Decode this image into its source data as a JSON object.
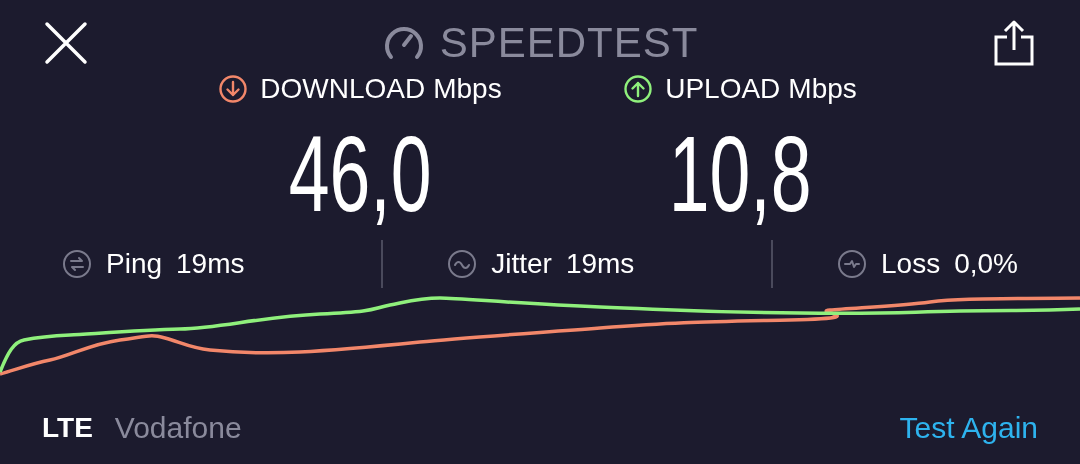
{
  "header": {
    "title": "SPEEDTEST"
  },
  "results": [
    {
      "kind": "download",
      "label": "DOWNLOAD",
      "unit": "Mbps",
      "value": "46,0"
    },
    {
      "kind": "upload",
      "label": "UPLOAD",
      "unit": "Mbps",
      "value": "10,8"
    }
  ],
  "stats": [
    {
      "kind": "ping",
      "label": "Ping",
      "value": "19ms"
    },
    {
      "kind": "jitter",
      "label": "Jitter",
      "value": "19ms"
    },
    {
      "kind": "loss",
      "label": "Loss",
      "value": "0,0%"
    }
  ],
  "footer": {
    "network_type": "LTE",
    "carrier": "Vodafone",
    "action": "Test Again"
  }
}
